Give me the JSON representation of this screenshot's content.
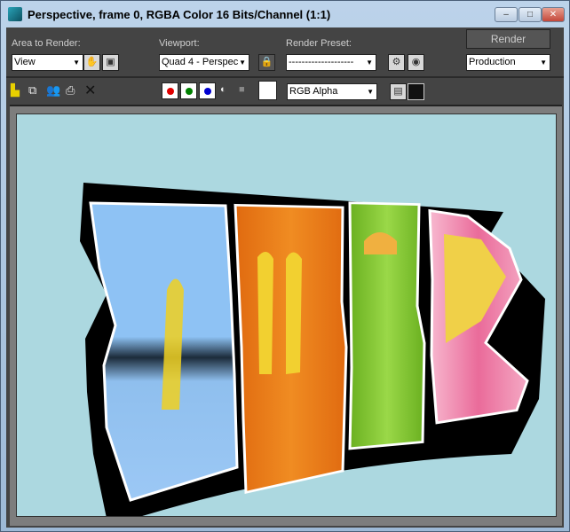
{
  "window": {
    "title": "Perspective, frame 0, RGBA Color 16 Bits/Channel (1:1)",
    "minimize": "–",
    "maximize": "□",
    "close": "✕"
  },
  "controls": {
    "area_label": "Area to Render:",
    "area_value": "View",
    "viewport_label": "Viewport:",
    "viewport_value": "Quad 4 - Perspec",
    "preset_label": "Render Preset:",
    "preset_value": "--------------------",
    "render_button": "Render",
    "mode_value": "Production"
  },
  "toolbar": {
    "channel_value": "RGB Alpha",
    "colors": {
      "red": "#e00000",
      "green": "#008000",
      "blue": "#0000d0"
    }
  },
  "canvas": {
    "background": "#acd8e0",
    "doors": [
      "blue",
      "orange",
      "green",
      "pink"
    ]
  }
}
